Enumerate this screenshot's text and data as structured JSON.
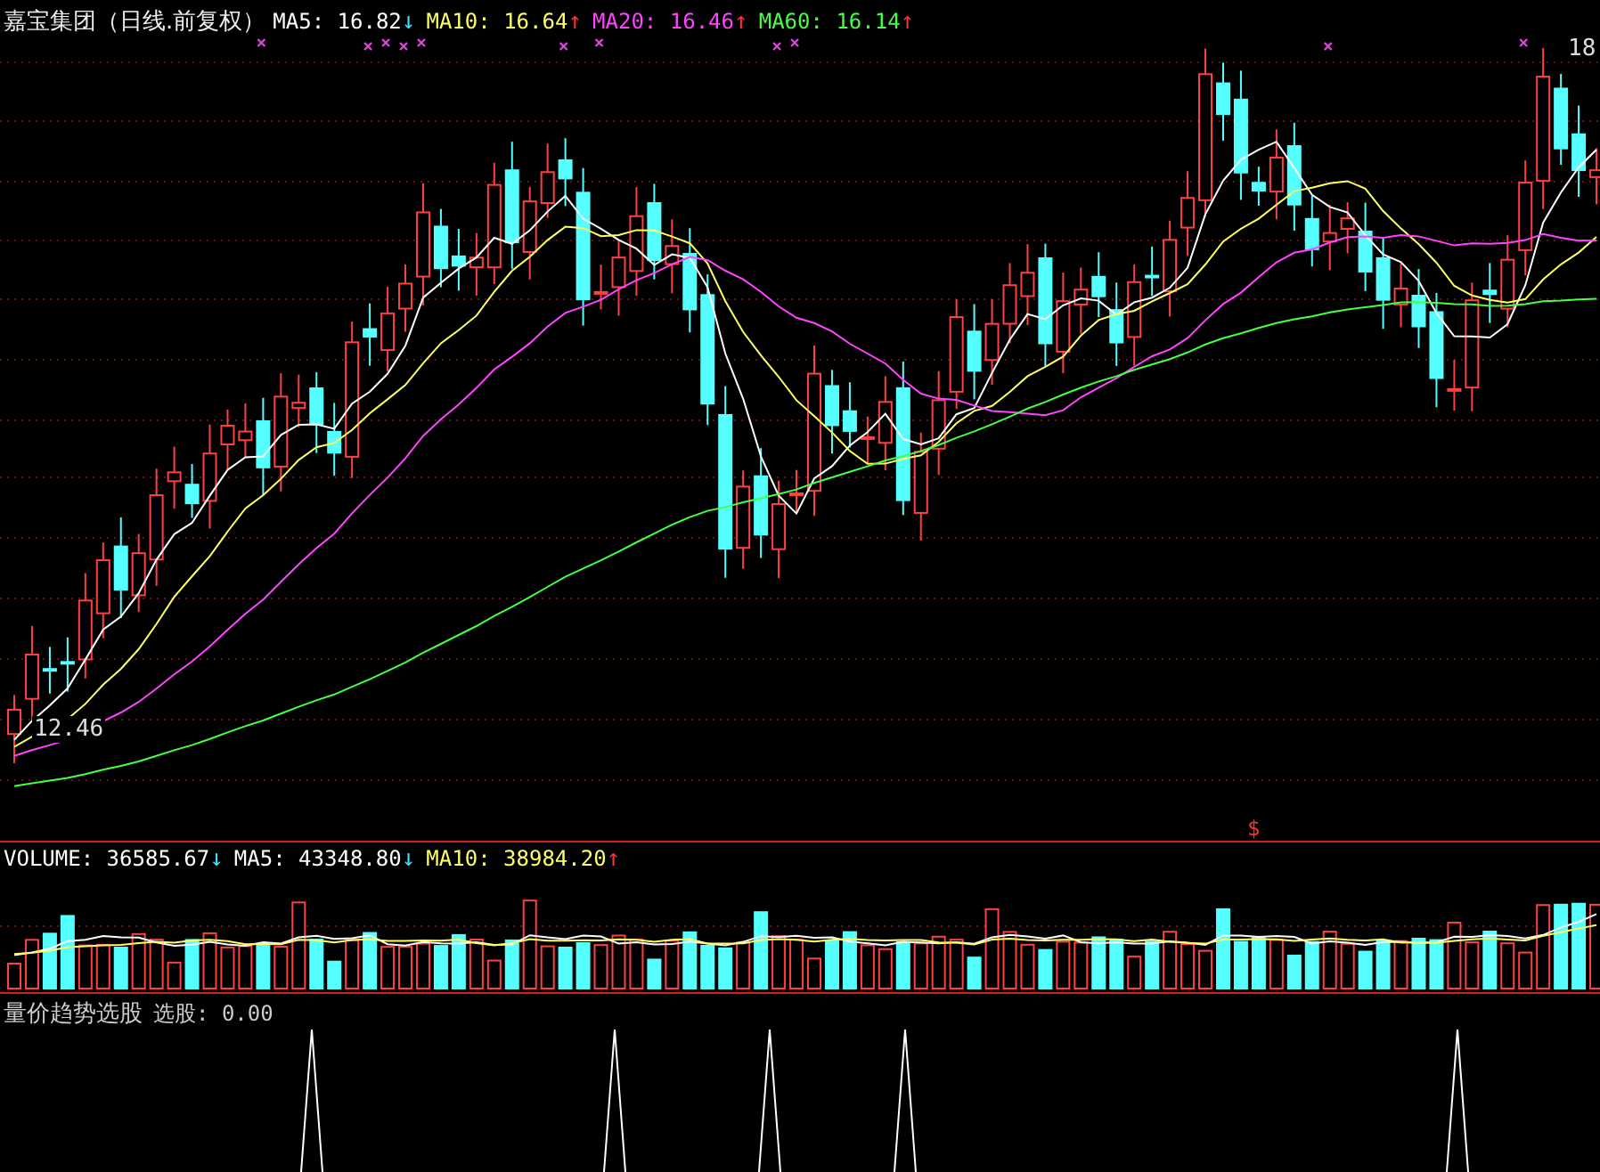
{
  "price_panel": {
    "title": "嘉宝集团（日线.前复权）",
    "averages": [
      {
        "label": "MA5:",
        "value": "16.82",
        "color": "#ffffff",
        "arrow": {
          "text": "↓",
          "color": "#44ddff"
        }
      },
      {
        "label": "MA10:",
        "value": "16.64",
        "color": "#ffff66",
        "arrow": {
          "text": "↑",
          "color": "#ff3030"
        }
      },
      {
        "label": "MA20:",
        "value": "16.46",
        "color": "#ff44ff",
        "arrow": {
          "text": "↑",
          "color": "#ff3030"
        }
      },
      {
        "label": "MA60:",
        "value": "16.14",
        "color": "#44ff44",
        "arrow": {
          "text": "↑",
          "color": "#ff3030"
        }
      }
    ],
    "high_label": "18",
    "low_label": "12.46",
    "signal_mark": "$"
  },
  "volume_panel": {
    "readings": [
      {
        "label": "VOLUME:",
        "value": "36585.67",
        "color": "#ffffff",
        "arrow": {
          "text": "↓",
          "color": "#44ddff"
        }
      },
      {
        "label": "MA5:",
        "value": "43348.80",
        "color": "#ffffff",
        "arrow": {
          "text": "↓",
          "color": "#44ddff"
        }
      },
      {
        "label": "MA10:",
        "value": "38984.20",
        "color": "#ffff66",
        "arrow": {
          "text": "↑",
          "color": "#ff3030"
        }
      }
    ]
  },
  "indicator_panel": {
    "title": "量价趋势选股",
    "reading": "选股: 0.00"
  }
}
